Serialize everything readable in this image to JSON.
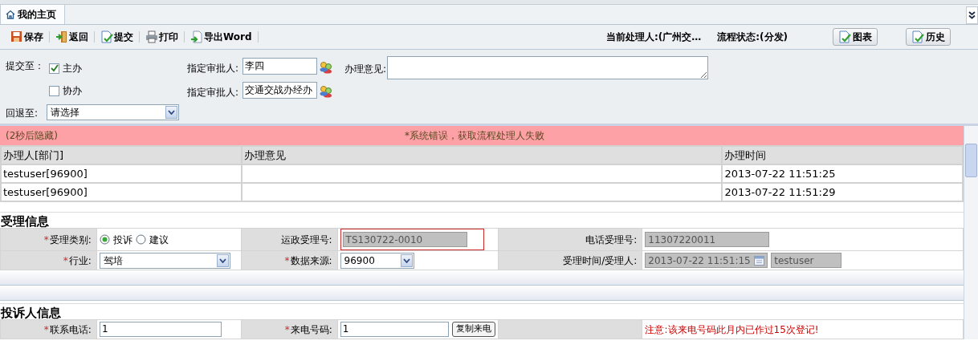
{
  "tab": {
    "label": "我的主页",
    "selected": true
  },
  "toolbar": {
    "buttons": [
      {
        "label": "保存",
        "kind": "save"
      },
      {
        "label": "返回",
        "kind": "back"
      },
      {
        "label": "提交",
        "kind": "submit"
      },
      {
        "label": "打印",
        "kind": "print"
      },
      {
        "label": "导出Word",
        "kind": "export"
      }
    ],
    "current_handler": "当前处理人:(广州交…",
    "flow_status": "流程状态:(分发)",
    "right_buttons": [
      "图表",
      "历史"
    ]
  },
  "submit_form": {
    "submit_to_label": "提交至：",
    "options": [
      {
        "label": "主办",
        "checked": true
      },
      {
        "label": "协办",
        "checked": false
      }
    ],
    "approvers": [
      {
        "label": "指定审批人:",
        "value": "李四"
      },
      {
        "label": "指定审批人:",
        "value": "交通交战办经办"
      }
    ],
    "opinion_label": "办理意见:",
    "return_label": "回退至:",
    "return_value": "请选择"
  },
  "alert": {
    "hint": "(2秒后隐藏)",
    "message": "*系统错误，获取流程处理人失败"
  },
  "history": {
    "columns": [
      "办理人[部门]",
      "办理意见",
      "办理时间"
    ],
    "rows": [
      [
        "testuser[96900]",
        "",
        "2013-07-22 11:51:25"
      ],
      [
        "testuser[96900]",
        "",
        "2013-07-22 11:51:29"
      ]
    ]
  },
  "sections": [
    {
      "title": "受理信息",
      "rows": [
        [
          {
            "star": "*",
            "label": "受理类别:",
            "field": {
              "kind": "radio",
              "options": [
                {
                  "label": "投诉",
                  "selected": true
                },
                {
                  "label": "建议",
                  "selected": false
                }
              ]
            }
          },
          {
            "label": "运政受理号:",
            "field": {
              "kind": "readonly",
              "value": "TS130722-0010",
              "flagged": true
            }
          },
          {
            "label": "电话受理号:",
            "field": {
              "kind": "readonly",
              "value": "11307220011"
            }
          }
        ],
        [
          {
            "star": "*",
            "label": "行业:",
            "field": {
              "kind": "select",
              "value": "驾培"
            }
          },
          {
            "star": "*",
            "label": "数据来源:",
            "field": {
              "kind": "select",
              "value": "96900"
            }
          },
          {
            "label": "受理时间/受理人:",
            "field": {
              "kind": "datetime",
              "value": "2013-07-22 11:51:15",
              "user": "testuser"
            }
          }
        ]
      ]
    },
    {
      "title": "投诉人信息",
      "rows": [
        [
          {
            "star": "*",
            "label": "联系电话:",
            "field": {
              "kind": "text",
              "value": "1"
            }
          },
          {
            "star": "*",
            "label": "来电号码:",
            "field": {
              "kind": "text",
              "value": "1",
              "button": "复制来电"
            }
          },
          {
            "field": {
              "kind": "note",
              "value": "注意:该来电号码此月内已作过15次登记!"
            }
          }
        ]
      ]
    }
  ]
}
